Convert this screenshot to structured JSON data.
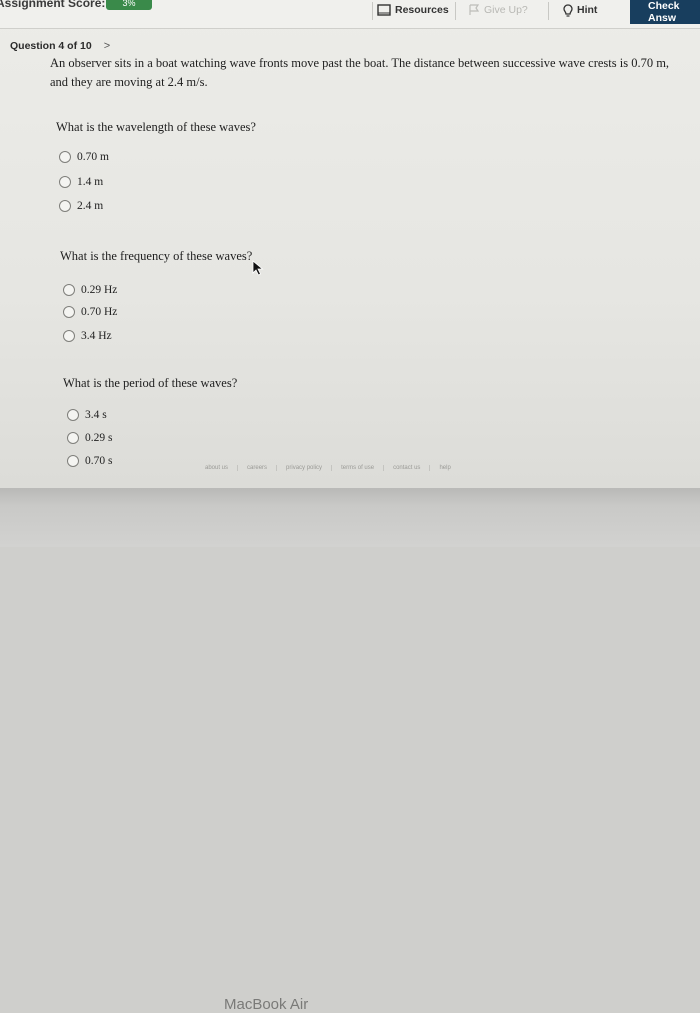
{
  "topbar": {
    "score_label": "Assignment Score:",
    "score_value": "3%",
    "resources_label": "Resources",
    "giveup_label": "Give Up?",
    "hint_label": "Hint",
    "check_label": "Check Answ"
  },
  "question_nav": {
    "label": "Question 4 of 10",
    "next_symbol": ">"
  },
  "stem": "An observer sits in a boat watching wave fronts move past the boat. The distance between successive wave crests is 0.70 m, and they are moving at 2.4 m/s.",
  "parts": [
    {
      "question": "What is the wavelength of these waves?",
      "options": [
        "0.70 m",
        "1.4 m",
        "2.4 m"
      ]
    },
    {
      "question": "What is the frequency of these waves?",
      "options": [
        "0.29 Hz",
        "0.70 Hz",
        "3.4 Hz"
      ]
    },
    {
      "question": "What is the period of these waves?",
      "options": [
        "3.4 s",
        "0.29 s",
        "0.70 s"
      ]
    }
  ],
  "footer_links": [
    "about us",
    "careers",
    "privacy policy",
    "terms of use",
    "contact us",
    "help"
  ],
  "bezel_text": "MacBook Air"
}
